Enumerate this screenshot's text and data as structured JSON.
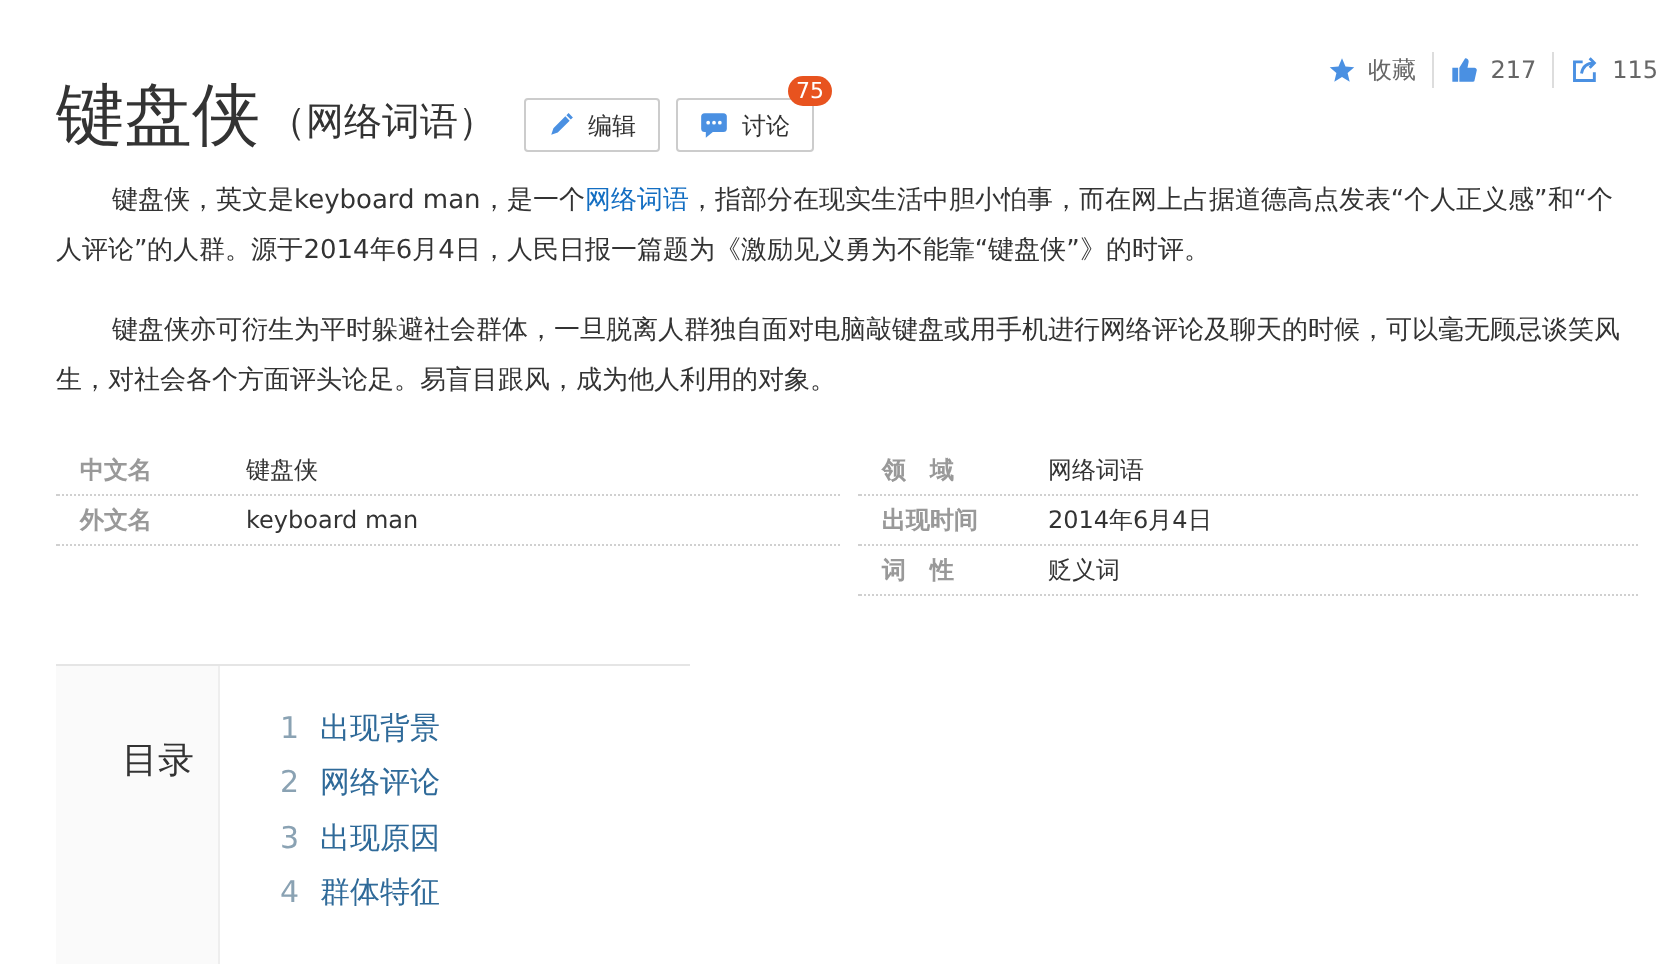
{
  "actions": [
    {
      "kind": "star",
      "label": "收藏"
    },
    {
      "kind": "like",
      "label": "217"
    },
    {
      "kind": "share",
      "label": "115"
    }
  ],
  "title": {
    "name": "键盘侠",
    "qualifier": "（网络词语）"
  },
  "buttons": [
    {
      "kind": "edit",
      "label": "编辑"
    },
    {
      "kind": "discuss",
      "label": "讨论",
      "badge": "75"
    }
  ],
  "paragraphs": [
    [
      {
        "kind": "text",
        "text": "键盘侠，英文是keyboard man，是一个"
      },
      {
        "kind": "link",
        "text": "网络词语"
      },
      {
        "kind": "text",
        "text": "，指部分在现实生活中胆小怕事，而在网上占据道德高点发表“个人正义感”和“个人评论”的人群。源于2014年6月4日，人民日报一篇题为《激励见义勇为不能靠“键盘侠”》的时评。"
      }
    ],
    [
      {
        "kind": "text",
        "text": "键盘侠亦可衍生为平时躲避社会群体，一旦脱离人群独自面对电脑敲键盘或用手机进行网络评论及聊天的时候，可以毫无顾忌谈笑风生，对社会各个方面评头论足。易盲目跟风，成为他人利用的对象。"
      }
    ]
  ],
  "info_left": [
    {
      "label": "中文名",
      "value": "键盘侠"
    },
    {
      "label": "外文名",
      "value": "keyboard man"
    }
  ],
  "info_right": [
    {
      "label": "领　域",
      "value": "网络词语"
    },
    {
      "label": "出现时间",
      "value": "2014年6月4日"
    },
    {
      "label": "词　性",
      "value": "贬义词"
    }
  ],
  "toc": {
    "title": "目录",
    "items": [
      {
        "number": "1",
        "label": "出现背景"
      },
      {
        "number": "2",
        "label": "网络评论"
      },
      {
        "number": "3",
        "label": "出现原因"
      },
      {
        "number": "4",
        "label": "群体特征"
      }
    ]
  }
}
